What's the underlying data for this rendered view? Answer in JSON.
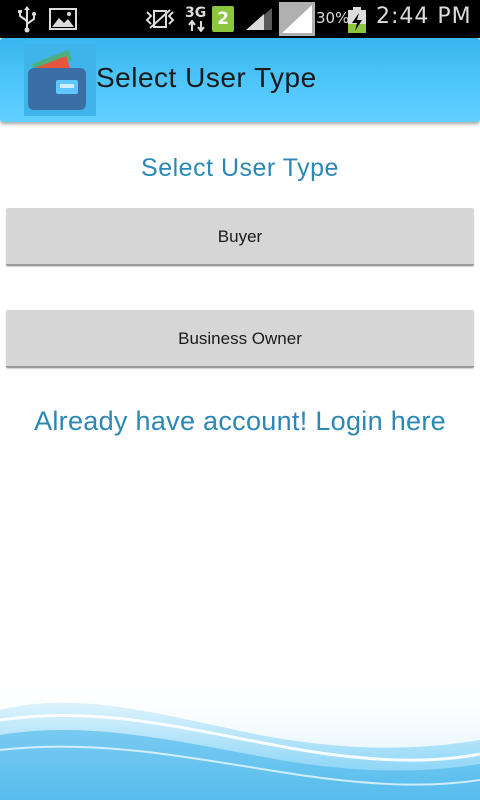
{
  "status_bar": {
    "network": "3G",
    "sim_slot": "2",
    "battery": "30%",
    "time": "2:44 PM"
  },
  "action_bar": {
    "title": "Select User Type"
  },
  "content": {
    "heading": "Select User Type",
    "buttons": [
      {
        "label": "Buyer"
      },
      {
        "label": "Business Owner"
      }
    ],
    "login_link": "Already have account! Login here"
  },
  "theme": {
    "accent": "#2a87b6",
    "action_bar": "#4fc6fb",
    "button_bg": "#d6d6d6",
    "sim_badge": "#8cc63f"
  }
}
